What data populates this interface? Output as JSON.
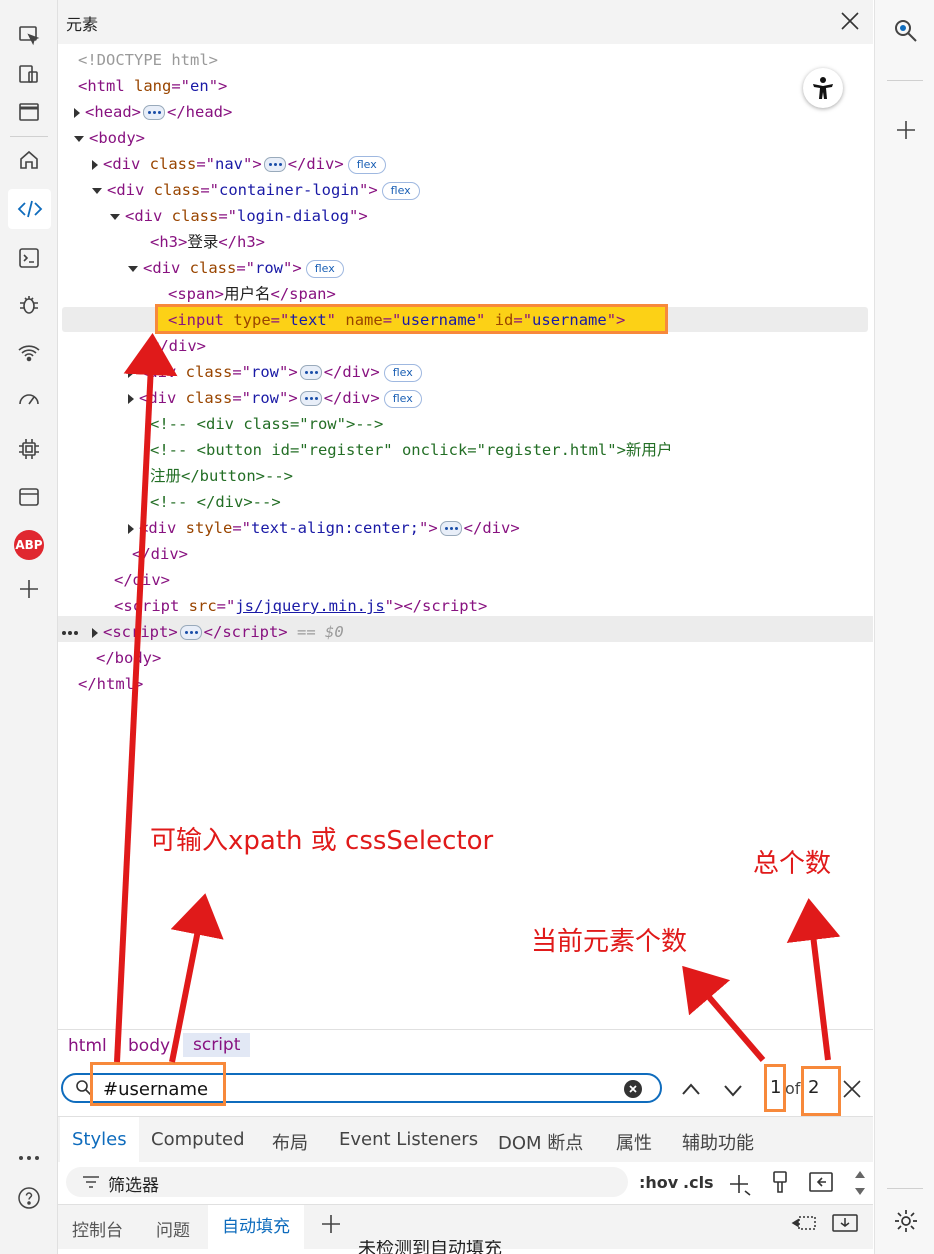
{
  "panel": {
    "title": "元素"
  },
  "dom_lines": [
    {
      "indent": 20,
      "arrow": "",
      "html": "<span class='gr'>&lt;!DOCTYPE html&gt;</span>"
    },
    {
      "indent": 20,
      "arrow": "",
      "html": "<span class='tag'>&lt;html</span> <span class='an'>lang</span><span class='tag'>=\"</span><span class='av'>en</span><span class='tag'>\"&gt;</span>"
    },
    {
      "indent": 28,
      "arrow": "r",
      "html": "<span class='tag'>&lt;head&gt;</span><span class='ell'></span><span class='tag'>&lt;/head&gt;</span>"
    },
    {
      "indent": 28,
      "arrow": "d",
      "html": "<span class='tag'>&lt;body&gt;</span>"
    },
    {
      "indent": 46,
      "arrow": "r",
      "html": "<span class='tag'>&lt;div</span> <span class='an'>class</span><span class='tag'>=\"</span><span class='av'>nav</span><span class='tag'>\"&gt;</span><span class='ell'></span><span class='tag'>&lt;/div&gt;</span><span class='badge'>flex</span>"
    },
    {
      "indent": 46,
      "arrow": "d",
      "html": "<span class='tag'>&lt;div</span> <span class='an'>class</span><span class='tag'>=\"</span><span class='av'>container-login</span><span class='tag'>\"&gt;</span><span class='badge'>flex</span>"
    },
    {
      "indent": 64,
      "arrow": "d",
      "html": "<span class='tag'>&lt;div</span> <span class='an'>class</span><span class='tag'>=\"</span><span class='av'>login-dialog</span><span class='tag'>\"&gt;</span>"
    },
    {
      "indent": 92,
      "arrow": "",
      "html": "<span class='tag'>&lt;h3&gt;</span><span class='tx'>登录</span><span class='tag'>&lt;/h3&gt;</span>"
    },
    {
      "indent": 82,
      "arrow": "d",
      "html": "<span class='tag'>&lt;div</span> <span class='an'>class</span><span class='tag'>=\"</span><span class='av'>row</span><span class='tag'>\"&gt;</span><span class='badge'>flex</span>"
    },
    {
      "indent": 110,
      "arrow": "",
      "html": "<span class='tag'>&lt;span&gt;</span><span class='tx'>用户名</span><span class='tag'>&lt;/span&gt;</span>"
    },
    {
      "indent": 110,
      "arrow": "",
      "html": "<span class='tag'>&lt;input</span> <span class='an'>type</span><span class='tag'>=\"</span><span class='av'>text</span><span class='tag'>\"</span> <span class='an'>name</span><span class='tag'>=\"</span><span class='av'>username</span><span class='tag'>\"</span> <span class='an'>id</span><span class='tag'>=\"</span><span class='av'>username</span><span class='tag'>\"&gt;</span>"
    },
    {
      "indent": 92,
      "arrow": "",
      "html": "<span class='tag'>&lt;/div&gt;</span>"
    },
    {
      "indent": 82,
      "arrow": "r",
      "html": "<span class='tag'>&lt;div</span> <span class='an'>class</span><span class='tag'>=\"</span><span class='av'>row</span><span class='tag'>\"&gt;</span><span class='ell'></span><span class='tag'>&lt;/div&gt;</span><span class='badge'>flex</span>"
    },
    {
      "indent": 82,
      "arrow": "r",
      "html": "<span class='tag'>&lt;div</span> <span class='an'>class</span><span class='tag'>=\"</span><span class='av'>row</span><span class='tag'>\"&gt;</span><span class='ell'></span><span class='tag'>&lt;/div&gt;</span><span class='badge'>flex</span>"
    },
    {
      "indent": 92,
      "arrow": "",
      "html": "<span class='cm'>&lt;!--            &lt;div class=\"row\"&gt;--&gt;</span>"
    },
    {
      "indent": 92,
      "arrow": "",
      "html": "<span class='cm'>&lt;!--                &lt;button id=\"register\" onclick=\"register.html\"&gt;新用户</span>"
    },
    {
      "indent": 92,
      "arrow": "",
      "html": "<span class='cm'>注册&lt;/button&gt;--&gt;</span>"
    },
    {
      "indent": 92,
      "arrow": "",
      "html": "<span class='cm'>&lt;!--            &lt;/div&gt;--&gt;</span>"
    },
    {
      "indent": 82,
      "arrow": "r",
      "html": "<span class='tag'>&lt;div</span> <span class='an'>style</span><span class='tag'>=\"</span><span class='av'>text-align:center;</span><span class='tag'>\"&gt;</span><span class='ell'></span><span class='tag'>&lt;/div&gt;</span>"
    },
    {
      "indent": 74,
      "arrow": "",
      "html": "<span class='tag'>&lt;/div&gt;</span>"
    },
    {
      "indent": 56,
      "arrow": "",
      "html": "<span class='tag'>&lt;/div&gt;</span>"
    },
    {
      "indent": 56,
      "arrow": "",
      "html": "<span class='tag'>&lt;script</span> <span class='an'>src</span><span class='tag'>=\"</span><span class='av' style='text-decoration:underline'>js/jquery.min.js</span><span class='tag'>\"&gt;&lt;/script&gt;</span>"
    },
    {
      "indent": 46,
      "arrow": "r",
      "html": "<span class='tag'>&lt;script&gt;</span><span class='ell'></span><span class='tag'>&lt;/script&gt;</span> <span class='gr' style='font-style:italic'>== $0</span>"
    },
    {
      "indent": 38,
      "arrow": "",
      "html": "<span class='tag'>&lt;/body&gt;</span>"
    },
    {
      "indent": 20,
      "arrow": "",
      "html": "<span class='tag'>&lt;/html&gt;</span>"
    }
  ],
  "annotations": {
    "input_hint": "可输入xpath 或 cssSelector",
    "total_count": "总个数",
    "current_index": "当前元素个数"
  },
  "breadcrumb": [
    "html",
    "body",
    "script"
  ],
  "search": {
    "value": "#username",
    "current": "1",
    "of_label": "of",
    "total": "2"
  },
  "tabs_top": [
    "Styles",
    "Computed",
    "布局",
    "Event Listeners",
    "DOM 断点",
    "属性",
    "辅助功能"
  ],
  "filter": {
    "placeholder": "筛选器",
    "hov": ":hov",
    "cls": ".cls"
  },
  "tabs_bottom": [
    "控制台",
    "问题",
    "自动填充"
  ],
  "bottom_cut_text": "未检测到自动填充",
  "colors": {
    "accent": "#0f6cbd",
    "annotation": "#e01a1a",
    "highlight_box": "#f7893b",
    "highlight_fill": "#fcd116"
  }
}
